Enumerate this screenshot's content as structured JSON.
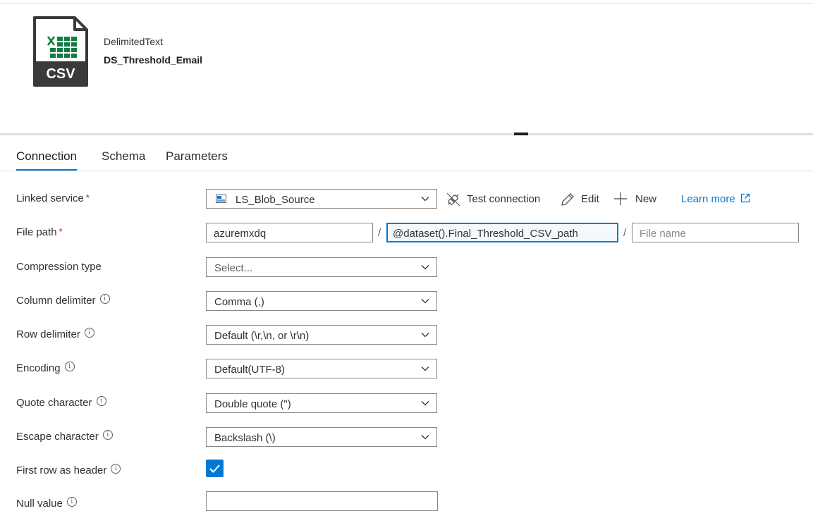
{
  "dataset": {
    "type": "DelimitedText",
    "name": "DS_Threshold_Email",
    "icon": "csv-file-icon",
    "icon_text": "CSV"
  },
  "tabs": [
    {
      "label": "Connection",
      "active": true
    },
    {
      "label": "Schema",
      "active": false
    },
    {
      "label": "Parameters",
      "active": false
    }
  ],
  "form": {
    "linked_service": {
      "label": "Linked service",
      "required": "*",
      "value": "LS_Blob_Source"
    },
    "actions": {
      "test_connection": "Test connection",
      "edit": "Edit",
      "new": "New",
      "learn_more": "Learn more"
    },
    "file_path": {
      "label": "File path",
      "required": "*",
      "container": "azuremxdq",
      "directory": "@dataset().Final_Threshold_CSV_path",
      "file_placeholder": "File name",
      "separator": "/"
    },
    "compression_type": {
      "label": "Compression type",
      "value": "Select..."
    },
    "column_delimiter": {
      "label": "Column delimiter",
      "value": "Comma (,)"
    },
    "row_delimiter": {
      "label": "Row delimiter",
      "value": "Default (\\r,\\n, or \\r\\n)"
    },
    "encoding": {
      "label": "Encoding",
      "value": "Default(UTF-8)"
    },
    "quote_character": {
      "label": "Quote character",
      "value": "Double quote (\")"
    },
    "escape_character": {
      "label": "Escape character",
      "value": "Backslash (\\)"
    },
    "first_row_header": {
      "label": "First row as header",
      "checked": true
    },
    "null_value": {
      "label": "Null value",
      "value": ""
    }
  },
  "info_glyph": "i",
  "colors": {
    "accent": "#0078d4",
    "excel_green": "#107c41",
    "required": "#a4262c"
  }
}
